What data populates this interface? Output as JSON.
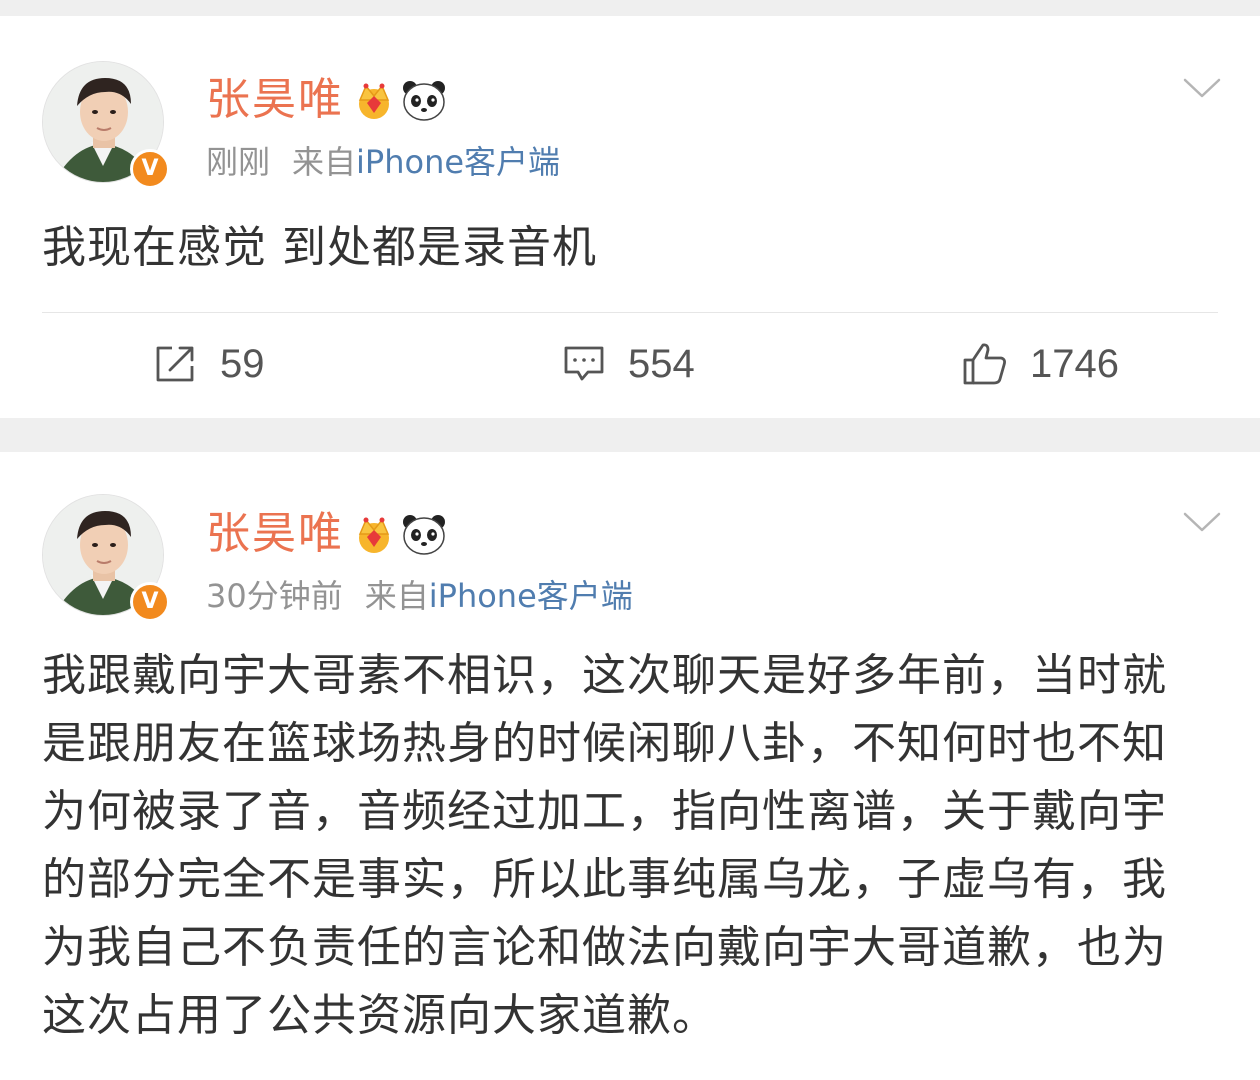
{
  "posts": [
    {
      "author": "张昊唯",
      "time": "刚刚",
      "source_prefix": "来自",
      "source": "iPhone客户端",
      "verified_badge": "V",
      "text": "我现在感觉 到处都是录音机",
      "actions": {
        "repost": "59",
        "comment": "554",
        "like": "1746"
      }
    },
    {
      "author": "张昊唯",
      "time": "30分钟前",
      "source_prefix": "来自",
      "source": "iPhone客户端",
      "verified_badge": "V",
      "text": "我跟戴向宇大哥素不相识，这次聊天是好多年前，当时就是跟朋友在篮球场热身的时候闲聊八卦，不知何时也不知为何被录了音，音频经过加工，指向性离谱，关于戴向宇的部分完全不是事实，所以此事纯属乌龙，子虚乌有，我为我自己不负责任的言论和做法向戴向宇大哥道歉，也为这次占用了公共资源向大家道歉。"
    }
  ],
  "icons": [
    "crown-icon",
    "panda-icon",
    "verified-badge-icon",
    "chevron-down-icon",
    "repost-icon",
    "comment-icon",
    "like-icon"
  ],
  "colors": {
    "author": "#eb7350",
    "source_link": "#507daf",
    "verified": "#f28a1e",
    "meta": "#939393"
  }
}
